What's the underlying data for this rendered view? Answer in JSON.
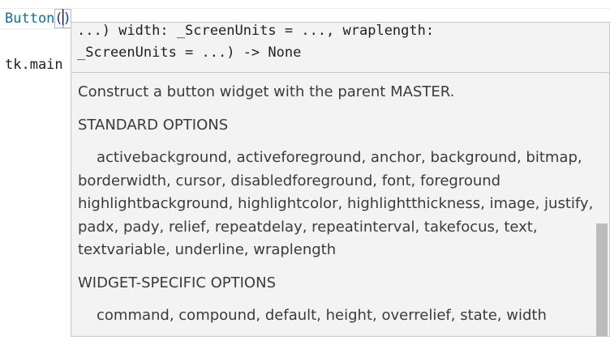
{
  "editor": {
    "line1": {
      "function_name": "Button",
      "open_paren": "(",
      "close_paren": ")"
    },
    "line2": {
      "text": "tk.main"
    }
  },
  "hover": {
    "signature_line1": "...) width: _ScreenUnits = ..., wraplength:",
    "signature_line2": "_ScreenUnits = ...) -> None",
    "description": "Construct a button widget with the parent MASTER.",
    "standard_heading": "STANDARD OPTIONS",
    "standard_options": "activebackground, activeforeground, anchor, background, bitmap, borderwidth, cursor, disabledforeground, font, foreground highlightbackground, highlightcolor, highlightthickness, image, justify, padx, pady, relief, repeatdelay, repeatinterval, takefocus, text, textvariable, underline, wraplength",
    "widget_heading": "WIDGET-SPECIFIC OPTIONS",
    "widget_options": "command, compound, default, height, overrelief, state, width"
  },
  "colors": {
    "function_name": "#0e6fa6",
    "paren": "#0431fa",
    "hover_background": "#f3f3f3",
    "hover_border": "#c8c8c8",
    "scrollbar_thumb": "#bcbcbc"
  }
}
